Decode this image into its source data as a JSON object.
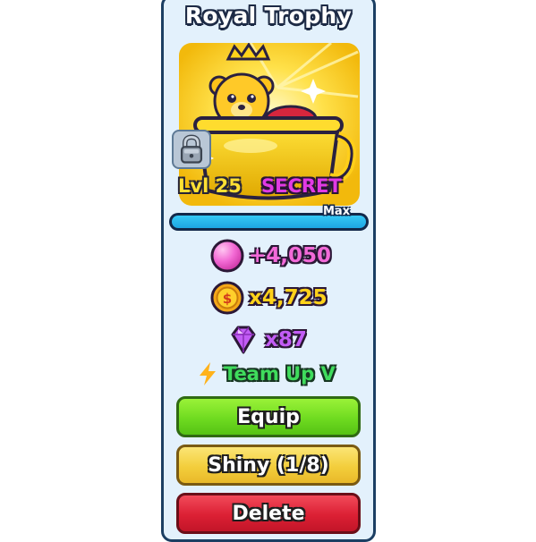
{
  "pet": {
    "name": "Royal Trophy",
    "level": "Lvl 25",
    "rarity": "SECRET",
    "progress_label": "Max",
    "progress_fraction": 1.0
  },
  "stats": [
    {
      "icon": "pink-orb-icon",
      "value": "+4,050",
      "color": "#f26ad8"
    },
    {
      "icon": "gold-coin-icon",
      "value": "x4,725",
      "color": "#ffd21a"
    },
    {
      "icon": "purple-diamond-icon",
      "value": "x87",
      "color": "#c25cf5"
    }
  ],
  "ability": {
    "icon": "lightning-bolt-icon",
    "label": "Team Up V"
  },
  "buttons": {
    "equip": "Equip",
    "shiny": "Shiny (1/8)",
    "delete": "Delete"
  },
  "colors": {
    "panel_bg": "#e3f1fc",
    "equip": "#6fdb20",
    "shiny": "#f3ce3c",
    "delete": "#dc2034",
    "rarity": "#e23ae5",
    "progress": "#1ea6e3"
  }
}
